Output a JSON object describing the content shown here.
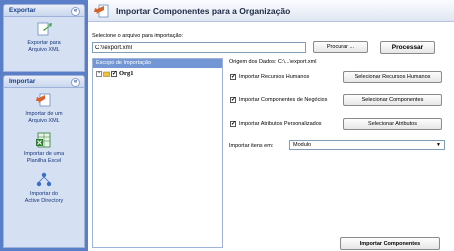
{
  "sidebar": {
    "export_panel": {
      "title": "Exportar",
      "items": [
        {
          "label": "Exportar para\nArquivo XML",
          "icon": "export-xml-icon"
        }
      ]
    },
    "import_panel": {
      "title": "Importar",
      "items": [
        {
          "label": "Importar de um\nArquivo XML",
          "icon": "import-xml-icon"
        },
        {
          "label": "Importar de uma\nPlanilha Excel",
          "icon": "excel-icon"
        },
        {
          "label": "Importar do\nActive Directory",
          "icon": "active-directory-icon"
        }
      ]
    },
    "toggle_glyph": "«"
  },
  "header": {
    "title": "Importar Componentes para a Organização"
  },
  "file": {
    "label": "Selecione o arquivo para importação:",
    "value": "C:\\\\export.xml",
    "browse_label": "Procurar ...",
    "process_label": "Processar"
  },
  "scope": {
    "header": "Escopo de Importação",
    "tree": [
      {
        "label": "Org1",
        "expander": "+",
        "checked": true
      }
    ]
  },
  "origin_text": "Origem dos Dados: C:\\...\\export.xml",
  "options": [
    {
      "label": "Importar Recursos Humanos",
      "checked": true,
      "button": "Selecionar Recursos Humanos"
    },
    {
      "label": "Importar Componentes de Negócios",
      "checked": true,
      "button": "Selecionar Componentes"
    },
    {
      "label": "Importar Atributos Personalizados",
      "checked": true,
      "button": "Selecionar Atributos"
    }
  ],
  "import_into": {
    "label": "Importar itens em:",
    "selected": "Modulo"
  },
  "footer": {
    "import_button": "Importar Componentes"
  },
  "colors": {
    "sidebar_bg": "#5b7ec9",
    "panel_body": "#d6e0f3",
    "header_accent": "#7397d4"
  }
}
